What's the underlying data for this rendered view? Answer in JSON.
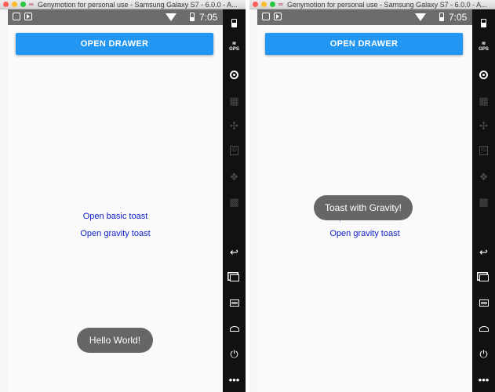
{
  "window_title": "Genymotion for personal use - Samsung Galaxy S7 - 6.0.0 - A...",
  "status_time": "7:05",
  "open_drawer_label": "OPEN DRAWER",
  "links": {
    "basic_toast": "Open basic toast",
    "gravity_toast": "Open gravity toast"
  },
  "toasts": {
    "left": "Hello World!",
    "right": "Toast with Gravity!"
  },
  "sidebar": {
    "gps_label": "GPS",
    "id_label": "ID",
    "icons": [
      "battery-icon",
      "gps-icon",
      "webcam-icon",
      "capture-icon",
      "dpad-icon",
      "id-icon",
      "rss-icon",
      "sms-icon",
      "back-icon",
      "recent-apps-icon",
      "menu-icon",
      "home-icon",
      "power-icon",
      "more-icon"
    ]
  },
  "colors": {
    "accent": "#2196f3",
    "link": "#1020c8",
    "toast_bg": "#666666",
    "status_bar": "#6c6c6c",
    "sidebar_bg": "#111111"
  }
}
